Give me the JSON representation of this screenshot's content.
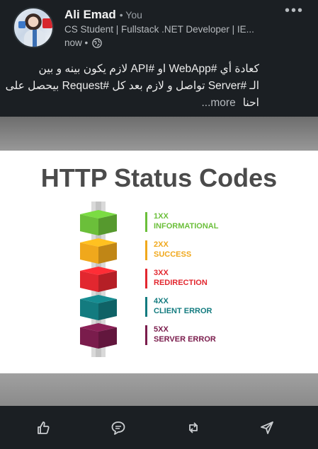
{
  "author": {
    "name": "Ali Emad",
    "you_badge": "• You",
    "headline": "CS Student | Fullstack .NET Developer | IE...",
    "time": "now •"
  },
  "post": {
    "line1": "كعادة أي #WebApp او #API لازم يكون بينه و بين",
    "line2": "الـ #Server تواصل و لازم بعد كل #Request بيحصل على",
    "line3": "احنا",
    "more": "...more"
  },
  "image": {
    "title": "HTTP Status Codes",
    "levels": [
      {
        "code": "1XX",
        "desc": "INFORMATIONAL",
        "color": "#6bbf3a"
      },
      {
        "code": "2XX",
        "desc": "SUCCESS",
        "color": "#f0a81c"
      },
      {
        "code": "3XX",
        "desc": "REDIRECTION",
        "color": "#e2272f"
      },
      {
        "code": "4XX",
        "desc": "CLIENT ERROR",
        "color": "#137b7f"
      },
      {
        "code": "5XX",
        "desc": "SERVER ERROR",
        "color": "#7a1c4c"
      }
    ]
  },
  "actions": [
    "like-icon",
    "comment-icon",
    "repost-icon",
    "send-icon"
  ],
  "colors": {
    "background": "#1b1f23",
    "text": "#ededed",
    "muted": "#b6babe"
  }
}
